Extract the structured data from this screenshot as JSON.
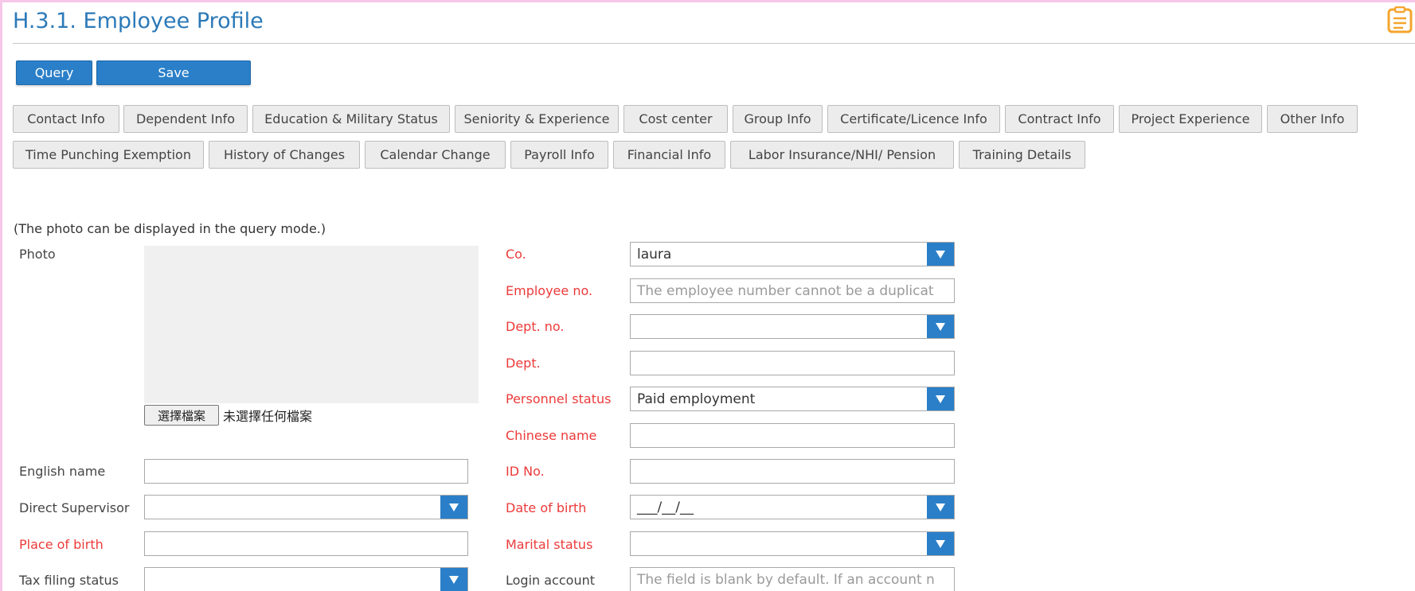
{
  "header": {
    "title": "H.3.1. Employee Profile",
    "icon": "clipboard-icon",
    "icon_color": "#f4a52c"
  },
  "toolbar": {
    "query_label": "Query",
    "save_label": "Save",
    "accent": "#2a7fc8"
  },
  "tabs": {
    "row1": [
      "Contact Info",
      "Dependent Info",
      "Education & Military Status",
      "Seniority & Experience",
      "Cost center",
      "Group Info",
      "Certificate/Licence Info",
      "Contract Info",
      "Project Experience",
      "Other Info"
    ],
    "row2": [
      "Time Punching Exemption",
      "History of Changes",
      "Calendar Change",
      "Payroll Info",
      "Financial Info",
      "Labor Insurance/NHI/ Pension",
      "Training Details"
    ]
  },
  "photo": {
    "note": "(The photo can be displayed in the query mode.)",
    "label": "Photo",
    "choose_file_label": "選擇檔案",
    "file_status": "未選擇任何檔案"
  },
  "left_form": {
    "english_name": {
      "label": "English name",
      "value": ""
    },
    "direct_supervisor": {
      "label": "Direct Supervisor",
      "value": ""
    },
    "place_of_birth": {
      "label": "Place of birth",
      "value": ""
    },
    "tax_filing_status": {
      "label": "Tax filing status",
      "value": ""
    }
  },
  "right_form": {
    "company": {
      "label": "Co.",
      "value": "laura"
    },
    "employee_no": {
      "label": "Employee no.",
      "placeholder": "The employee number cannot be a duplicat"
    },
    "dept_no": {
      "label": "Dept. no.",
      "value": ""
    },
    "dept": {
      "label": "Dept.",
      "value": ""
    },
    "personnel_status": {
      "label": "Personnel status",
      "value": "Paid employment"
    },
    "chinese_name": {
      "label": "Chinese name",
      "value": ""
    },
    "id_no": {
      "label": "ID No.",
      "value": ""
    },
    "date_of_birth": {
      "label": "Date of birth",
      "value": "___/__/__"
    },
    "marital_status": {
      "label": "Marital status",
      "value": ""
    },
    "login_account": {
      "label": "Login account",
      "placeholder": "The field is blank by default. If an account n"
    }
  },
  "colors": {
    "required_label": "#ec3a3a",
    "title": "#2b79b8"
  }
}
